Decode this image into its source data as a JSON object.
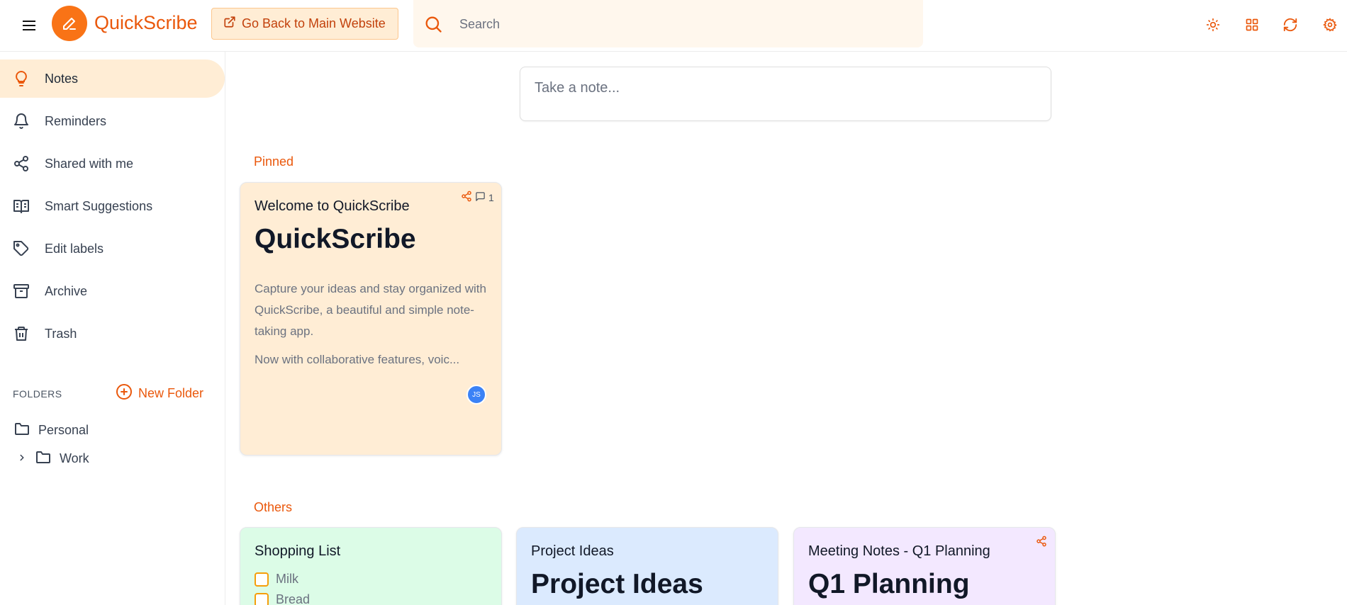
{
  "header": {
    "app_title": "QuickScribe",
    "back_button_label": "Go Back to Main Website",
    "search_placeholder": "Search",
    "icons": [
      "menu-icon",
      "pencil-icon",
      "external-link-icon",
      "search-icon",
      "sun-icon",
      "grid-view-icon",
      "refresh-icon",
      "settings-icon"
    ]
  },
  "sidebar": {
    "items": [
      {
        "label": "Notes",
        "icon": "lightbulb-icon",
        "active": true
      },
      {
        "label": "Reminders",
        "icon": "bell-icon"
      },
      {
        "label": "Shared with me",
        "icon": "share-icon"
      },
      {
        "label": "Smart Suggestions",
        "icon": "book-open-icon"
      },
      {
        "label": "Edit labels",
        "icon": "tag-icon"
      },
      {
        "label": "Archive",
        "icon": "archive-icon"
      },
      {
        "label": "Trash",
        "icon": "trash-icon"
      }
    ],
    "folders_heading": "FOLDERS",
    "new_folder_label": "New Folder",
    "folders": [
      {
        "label": "Personal"
      },
      {
        "label": "Work"
      }
    ]
  },
  "main": {
    "take_note_placeholder": "Take a note...",
    "pinned_label": "Pinned",
    "others_label": "Others",
    "pinned_notes": [
      {
        "title": "Welcome to QuickScribe",
        "heading": "QuickScribe",
        "paragraph1": "Capture your ideas and stay organized with QuickScribe, a beautiful and simple note-taking app.",
        "paragraph2": "Now with collaborative features, voic...",
        "comment_count": "1",
        "avatar_initials": "JS",
        "bg_color": "#ffedd5"
      }
    ],
    "other_notes": [
      {
        "title": "Shopping List",
        "checklist": [
          "Milk",
          "Bread"
        ],
        "bg_color": "#dcfce7"
      },
      {
        "title": "Project Ideas",
        "heading": "Project Ideas",
        "bg_color": "#dbeafe"
      },
      {
        "title": "Meeting Notes - Q1 Planning",
        "heading": "Q1 Planning",
        "bg_color": "#f3e8ff"
      }
    ]
  },
  "colors": {
    "accent": "#f97316",
    "accent_text": "#ea580c"
  }
}
